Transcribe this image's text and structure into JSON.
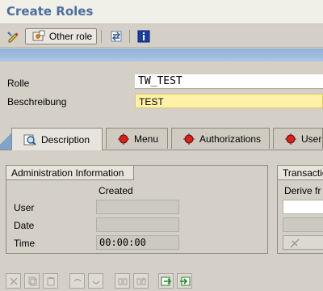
{
  "window": {
    "title": "Create Roles"
  },
  "toolbar": {
    "other_role_label": "Other role",
    "icons": [
      "edit-pencil-icon",
      "other-role-icon",
      "switch-icon",
      "info-icon"
    ]
  },
  "fields": {
    "rolle_label": "Rolle",
    "rolle_value": "TW_TEST",
    "beschreibung_label": "Beschreibung",
    "beschreibung_value": "TEST"
  },
  "tabs": [
    {
      "label": "Description",
      "status": "active",
      "icon": "description-icon"
    },
    {
      "label": "Menu",
      "status": "red",
      "icon": "red-status-icon"
    },
    {
      "label": "Authorizations",
      "status": "red",
      "icon": "red-status-icon"
    },
    {
      "label": "User",
      "status": "red",
      "icon": "red-status-icon"
    }
  ],
  "admin_info": {
    "title": "Administration Information",
    "column_header": "Created",
    "rows": [
      {
        "label": "User",
        "value": ""
      },
      {
        "label": "Date",
        "value": ""
      },
      {
        "label": "Time",
        "value": "00:00:00"
      }
    ]
  },
  "transaction": {
    "title": "Transactio",
    "derive_label": "Derive fr"
  },
  "colors": {
    "title": "#4e6ea0",
    "required_field": "#fff1a8",
    "status_red": "#e21b1b",
    "band_blue": "#a9c5e4"
  }
}
